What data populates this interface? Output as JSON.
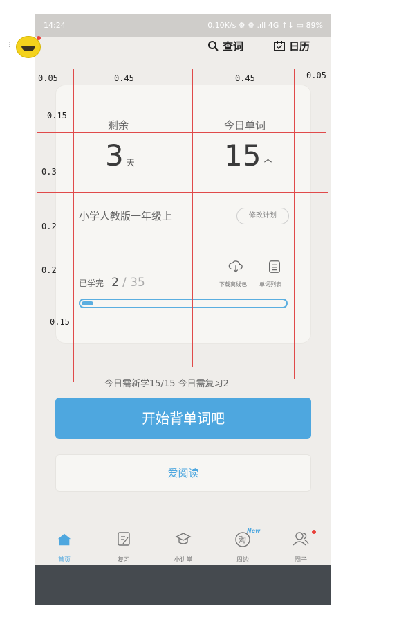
{
  "status": {
    "time": "14:24",
    "right": "0.10K/s ⚙ ⚙ .ıll 4G ↑↓ ▭ 89%"
  },
  "header": {
    "search_label": "查词",
    "calendar_label": "日历"
  },
  "card": {
    "remaining_label": "剩余",
    "remaining_value": "3",
    "remaining_unit": "天",
    "today_words_label": "今日单词",
    "today_words_value": "15",
    "today_words_unit": "个",
    "plan_name": "小学人教版一年级上",
    "edit_plan_label": "修改计划",
    "learned_label": "已学完",
    "learned_value": "2",
    "total_value": "/ 35",
    "download_label": "下载离线包",
    "wordlist_label": "单词列表",
    "progress": 0.057
  },
  "summary": "今日需新学15/15 今日需复习2",
  "start_label": "开始背单词吧",
  "read_label": "爱阅读",
  "nav": {
    "items": [
      {
        "label": "首页"
      },
      {
        "label": "复习"
      },
      {
        "label": "小讲堂"
      },
      {
        "label": "周边"
      },
      {
        "label": "圈子"
      }
    ],
    "new_badge": "New",
    "taobao_glyph": "淘"
  },
  "annotations": {
    "col_left": "0.05",
    "col_mid1": "0.45",
    "col_mid2": "0.45",
    "col_right": "0.05",
    "row1": "0.15",
    "row2": "0.3",
    "row3": "0.2",
    "row4": "0.2",
    "row5": "0.15"
  },
  "colors": {
    "accent": "#4ea7df",
    "annotation_line": "#e04a4a"
  }
}
